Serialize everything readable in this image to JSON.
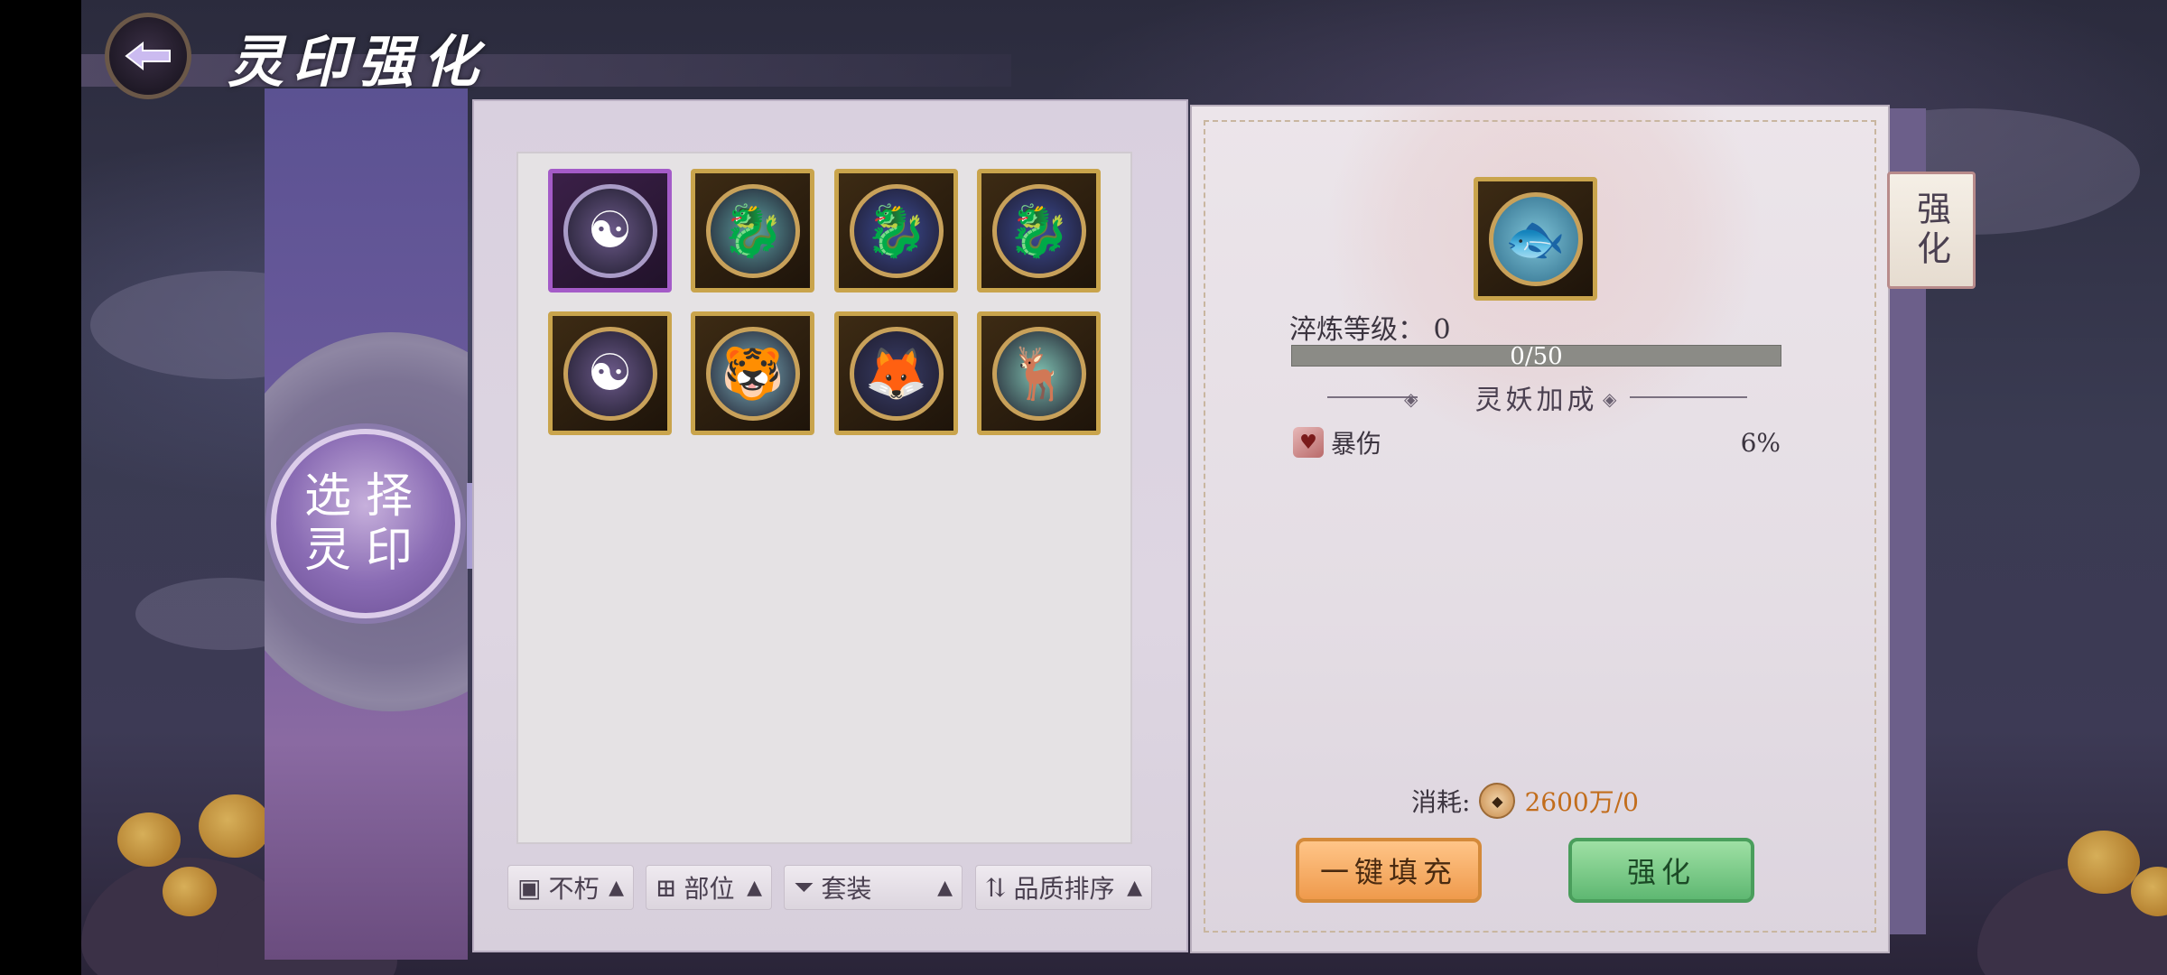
{
  "header": {
    "title": "灵印强化",
    "back_icon": "back-arrow-icon"
  },
  "sidebar": {
    "select_label_line1": "选择",
    "select_label_line2": "灵印"
  },
  "inventory": {
    "items": [
      {
        "icon": "spirit-seal-icon",
        "rarity": "purple",
        "glyph": "☯"
      },
      {
        "icon": "spirit-seal-icon",
        "rarity": "gold",
        "glyph": "🐉"
      },
      {
        "icon": "spirit-seal-icon",
        "rarity": "gold",
        "glyph": "🐉"
      },
      {
        "icon": "spirit-seal-icon",
        "rarity": "gold",
        "glyph": "🐉"
      },
      {
        "icon": "spirit-seal-icon",
        "rarity": "gold",
        "glyph": "☯"
      },
      {
        "icon": "spirit-seal-icon",
        "rarity": "gold",
        "glyph": "🐯"
      },
      {
        "icon": "spirit-seal-icon",
        "rarity": "gold",
        "glyph": "🦊"
      },
      {
        "icon": "spirit-seal-icon",
        "rarity": "gold",
        "glyph": "🦌"
      }
    ],
    "filters": {
      "immortal": "不朽",
      "slot": "部位",
      "set": "套装",
      "quality_sort": "品质排序"
    }
  },
  "detail": {
    "level_label": "淬炼等级：",
    "level_value": "0",
    "progress_text": "0/50",
    "progress_fraction": 0,
    "section_title": "灵妖加成",
    "stat_name": "暴伤",
    "stat_value": "6%",
    "cost_label": "消耗:",
    "cost_value": "2600万/0",
    "fill_button": "一键填充",
    "enhance_button": "强化"
  },
  "side_tab": {
    "label": "强化"
  },
  "colors": {
    "accent_gold": "#c9a44c",
    "purple_rarity": "#a45bc8",
    "cost_orange": "#c26d1c"
  }
}
